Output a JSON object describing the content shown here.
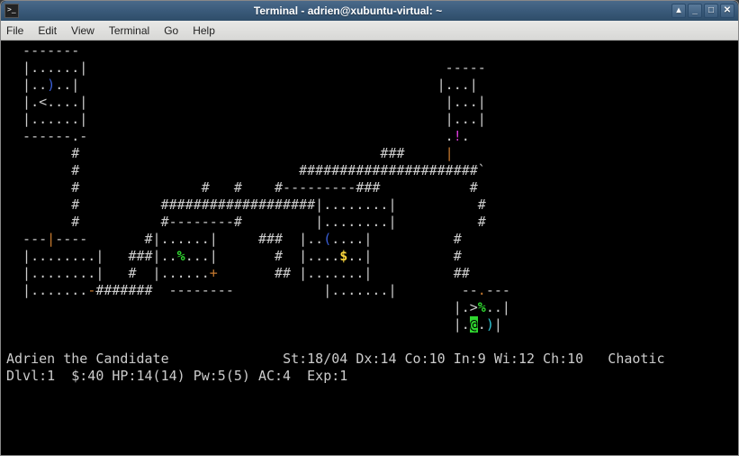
{
  "window": {
    "title": "Terminal - adrien@xubuntu-virtual: ~",
    "controls": {
      "shade": "▴",
      "min": "_",
      "max": "□",
      "close": "✕"
    }
  },
  "menubar": {
    "file": "File",
    "edit": "Edit",
    "view": "View",
    "terminal": "Terminal",
    "go": "Go",
    "help": "Help"
  },
  "game": {
    "map": {
      "r01": "  -------                                                           ",
      "r02": "  |......|                                            -----         ",
      "r03a": "  |..",
      "r03b": ")",
      "r03c": "..|                                            |...|         ",
      "r04": "  |.<....|                                            |...|         ",
      "r05": "  |......|                                            |...|         ",
      "r06a": "  ------.-                                            .",
      "r06b": "!",
      "r06c": ".           ",
      "r07a": "        #                                     ###     ",
      "r07b": "|",
      "r07c": "             ",
      "r08": "        #                           ######################`         ",
      "r09": "        #               #   #    #---------###           #          ",
      "r10": "        #          ###################|........|          #          ",
      "r11": "        #          #--------#         |........|          #          ",
      "r12a": "  ---",
      "r12b": "|",
      "r12c": "----       #|......|     ###  |..",
      "r12d": "(",
      "r12e": "....|          #          ",
      "r13a": "  |........|   ###|..",
      "r13b": "%",
      "r13c": "...|       #  |....",
      "r13d": "$",
      "r13e": "..|          #          ",
      "r14a": "  |........|   #  |......",
      "r14b": "+",
      "r14c": "       ## |.......|          ##         ",
      "r15a": "  |.......",
      "r15b": "-",
      "r15c": "#######  --------           |.......|        --",
      "r15d": ".",
      "r15e": "---       ",
      "r16a": "                                                       |.>",
      "r16b": "%",
      "r16c": "..|      ",
      "r17a": "                                                       |.",
      "r17b": "@",
      "r17c": ".",
      "r17d": ")",
      "r17e": "|      "
    },
    "status1a": "Adrien the Candidate",
    "status1b": "St:18/04 Dx:14 Co:10 In:9 Wi:12 Ch:10   Chaotic",
    "status2": "Dlvl:1  $:40 HP:14(14) Pw:5(5) AC:4  Exp:1"
  }
}
